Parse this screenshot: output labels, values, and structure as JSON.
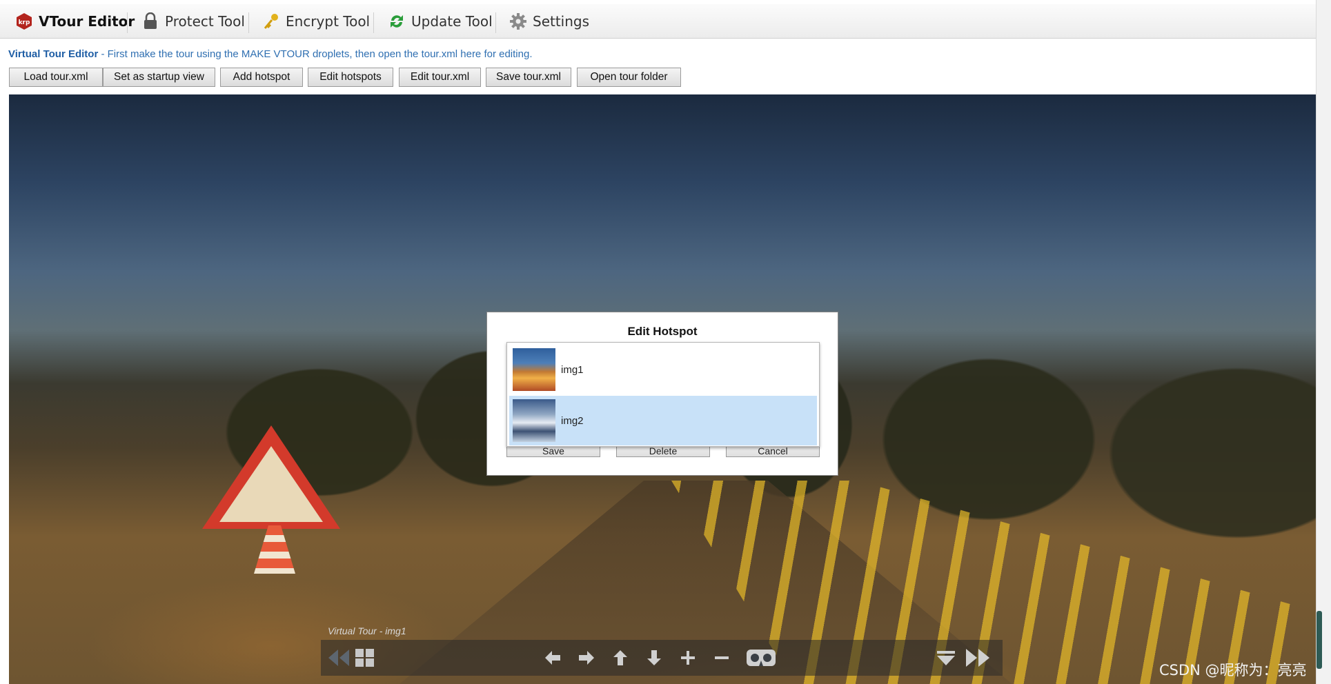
{
  "toolbar": {
    "tabs": [
      {
        "label": "VTour Editor",
        "icon": "vtour-logo-icon"
      },
      {
        "label": "Protect Tool",
        "icon": "lock-icon"
      },
      {
        "label": "Encrypt Tool",
        "icon": "key-icon"
      },
      {
        "label": "Update Tool",
        "icon": "refresh-icon"
      },
      {
        "label": "Settings",
        "icon": "gear-icon"
      }
    ]
  },
  "description": {
    "title": "Virtual Tour Editor",
    "text": " - First make the tour using the MAKE VTOUR droplets, then open the tour.xml here for editing."
  },
  "buttons": [
    "Load tour.xml",
    "Set as startup view",
    "Add hotspot",
    "Edit hotspots",
    "Edit tour.xml",
    "Save tour.xml",
    "Open tour folder"
  ],
  "dialog": {
    "title": "Edit Hotspot",
    "options": [
      {
        "label": "img1",
        "selected": false
      },
      {
        "label": "img2",
        "selected": true
      }
    ],
    "actions": [
      "Save",
      "Delete",
      "Cancel"
    ]
  },
  "viewer": {
    "label": "Virtual Tour - img1",
    "controls": [
      "prev-scene-icon",
      "thumbnails-icon",
      "arrow-left-icon",
      "arrow-right-icon",
      "arrow-up-icon",
      "arrow-down-icon",
      "zoom-in-icon",
      "zoom-out-icon",
      "vr-goggles-icon",
      "hide-controls-icon",
      "next-scene-icon"
    ]
  },
  "watermark": "CSDN @昵称为：亮亮",
  "colors": {
    "accent": "#2f6fb1",
    "selection": "#c8e1f8"
  }
}
